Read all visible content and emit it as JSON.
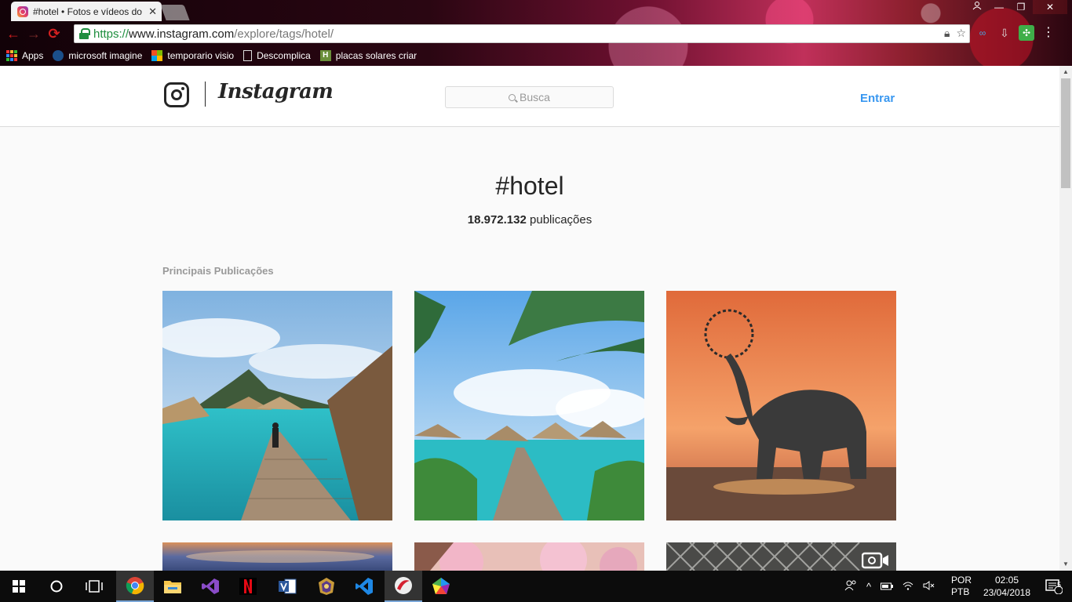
{
  "browser": {
    "tab_title": "#hotel • Fotos e vídeos do Instagram",
    "tab_close": "✕",
    "window_controls": [
      "—",
      "❐",
      "✕"
    ],
    "url_scheme": "https://",
    "url_host": "www.instagram.com",
    "url_path": "/explore/tags/hotel/",
    "bookmarks": [
      {
        "label": "Apps",
        "icon": "apps-grid-icon"
      },
      {
        "label": "microsoft imagine",
        "icon": "microsoft-imagine-icon"
      },
      {
        "label": "temporario visio",
        "icon": "windows-logo-icon"
      },
      {
        "label": "Descomplica",
        "icon": "page-icon"
      },
      {
        "label": "placas solares criar",
        "icon": "h-favicon-icon"
      }
    ]
  },
  "instagram": {
    "wordmark": "Instagram",
    "search_placeholder": "Busca",
    "login": "Entrar",
    "tag": "#hotel",
    "post_count": "18.972.132",
    "post_count_suffix": "publicações",
    "section_label": "Principais Publicações",
    "posts": [
      {
        "subject": "overwater bungalows boardwalk",
        "type": "image"
      },
      {
        "subject": "palm trees overwater bungalows",
        "type": "image"
      },
      {
        "subject": "elephant sunset water splash",
        "type": "image"
      },
      {
        "subject": "sunset sky",
        "type": "image"
      },
      {
        "subject": "pink flowers",
        "type": "image"
      },
      {
        "subject": "lattice pattern",
        "type": "video"
      }
    ]
  },
  "taskbar": {
    "apps": [
      "start",
      "search",
      "task-view",
      "chrome",
      "file-explorer",
      "visual-studio",
      "netflix",
      "visio",
      "game",
      "vscode",
      "app-red",
      "app-colorful"
    ],
    "language_top": "POR",
    "language_bottom": "PTB",
    "time": "02:05",
    "date": "23/04/2018",
    "notification_count": "5"
  },
  "colors": {
    "instagram_blue": "#3897f0",
    "secure_green": "#1e8e3e",
    "page_bg": "#fafafa"
  }
}
